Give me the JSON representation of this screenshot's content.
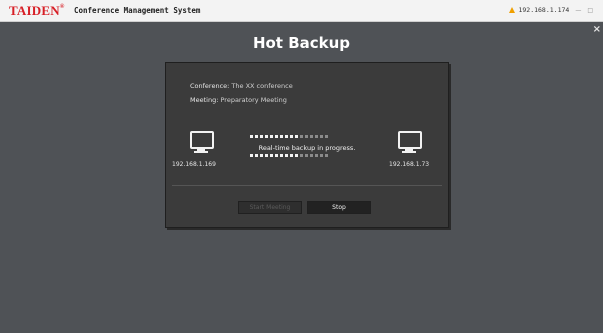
{
  "titlebar": {
    "brand": "TAIDEN",
    "brand_mark": "®",
    "app_title": "Conference Management System",
    "ip": "192.168.1.174",
    "min_label": "—",
    "max_label": "□"
  },
  "page": {
    "title": "Hot Backup",
    "close_label": "×"
  },
  "dialog": {
    "conference_label": "Conference:",
    "conference_value": "The XX conference",
    "meeting_label": "Meeting:",
    "meeting_value": "Preparatory Meeting",
    "left_ip": "192.168.1.169",
    "right_ip": "192.168.1.73",
    "progress_text": "Real-time backup in progress.",
    "start_button": "Start Meeting",
    "stop_button": "Stop",
    "progress_dots_total": 16,
    "progress_dots_active": 10
  },
  "icons": {
    "warning": "warning-icon",
    "monitor": "monitor-icon",
    "close": "close-icon"
  },
  "colors": {
    "background": "#4f5256",
    "brand": "#d71f26",
    "dialog": "#3b3b3b",
    "warning": "#f0a000"
  }
}
